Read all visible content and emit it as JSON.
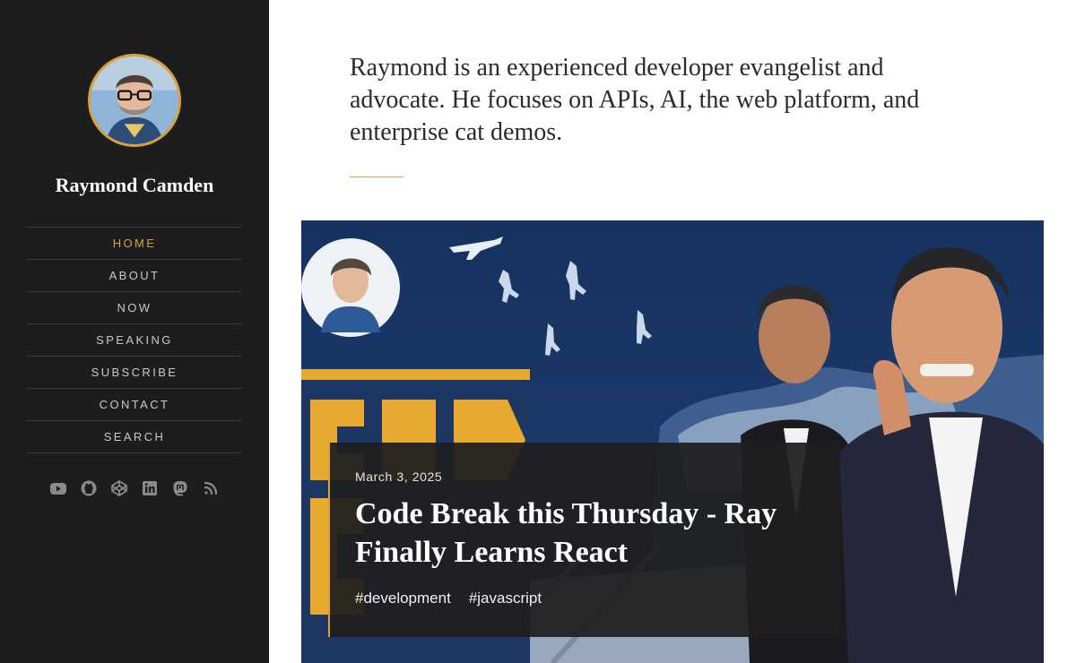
{
  "sidebar": {
    "site_name": "Raymond Camden",
    "nav": [
      "HOME",
      "ABOUT",
      "NOW",
      "SPEAKING",
      "SUBSCRIBE",
      "CONTACT",
      "SEARCH"
    ],
    "active_nav": "HOME",
    "social_icons": [
      "youtube-icon",
      "github-icon",
      "codepen-icon",
      "linkedin-icon",
      "mastodon-icon",
      "rss-icon"
    ]
  },
  "intro": {
    "text": "Raymond is an experienced developer evangelist and advocate. He focuses on APIs, AI, the web platform, and enterprise cat demos."
  },
  "post": {
    "date": "March 3, 2025",
    "title": "Code Break this Thursday - Ray Finally Learns React",
    "tags": [
      "#development",
      "#javascript"
    ]
  },
  "colors": {
    "sidebar_bg": "#1d1d1d",
    "accent": "#d9a13b",
    "text_dark": "#2b2b2b",
    "hero_sky": "#17305e"
  }
}
